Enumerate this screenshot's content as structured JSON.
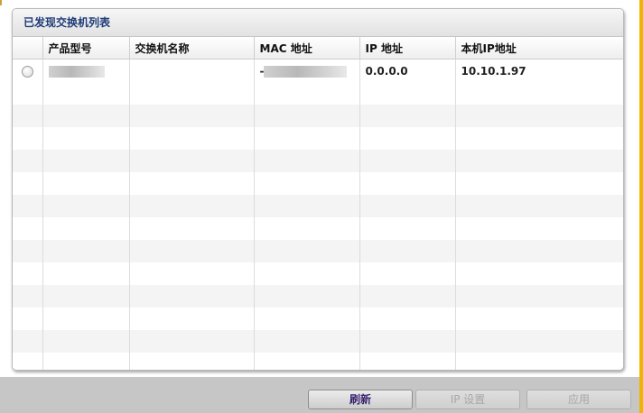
{
  "panel": {
    "title": "已发现交换机列表"
  },
  "table": {
    "columns": [
      "",
      "产品型号",
      "交换机名称",
      "MAC 地址",
      "IP 地址",
      "本机IP地址"
    ],
    "rows": [
      {
        "selected": false,
        "product_model": "",
        "switch_name": "",
        "mac_address": "-",
        "ip_address": "0.0.0.0",
        "local_ip": "10.10.1.97"
      }
    ]
  },
  "buttons": {
    "refresh": "刷新",
    "ip_settings": "IP 设置",
    "apply": "应用"
  },
  "colors": {
    "title": "#1e3c78",
    "right_bar": "#f0b400",
    "refresh_text": "#3a2570",
    "disabled_text": "#a7a7a7"
  }
}
